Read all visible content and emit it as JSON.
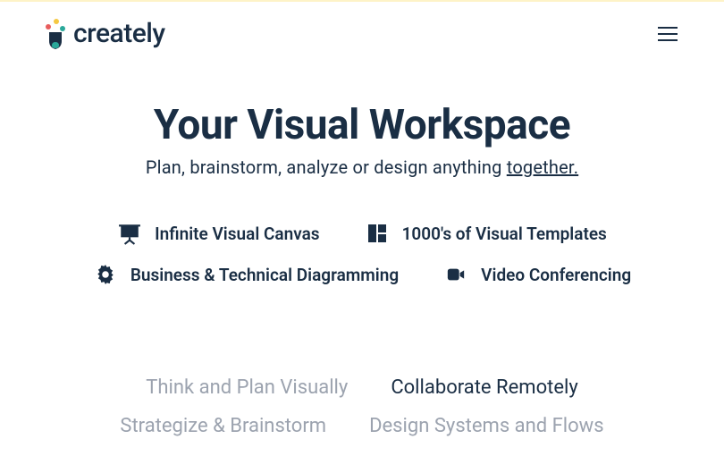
{
  "brand": {
    "name": "creately"
  },
  "hero": {
    "title": "Your Visual Workspace",
    "subtitle_prefix": "Plan, brainstorm, analyze or design anything ",
    "subtitle_underlined": "together."
  },
  "features": [
    {
      "label": "Infinite Visual Canvas"
    },
    {
      "label": "1000's of Visual Templates"
    },
    {
      "label": "Business & Technical Diagramming"
    },
    {
      "label": "Video Conferencing"
    }
  ],
  "links": [
    {
      "label": "Think and Plan Visually",
      "active": false
    },
    {
      "label": "Collaborate Remotely",
      "active": true
    },
    {
      "label": "Strategize & Brainstorm",
      "active": false
    },
    {
      "label": "Design Systems and Flows",
      "active": false
    }
  ]
}
